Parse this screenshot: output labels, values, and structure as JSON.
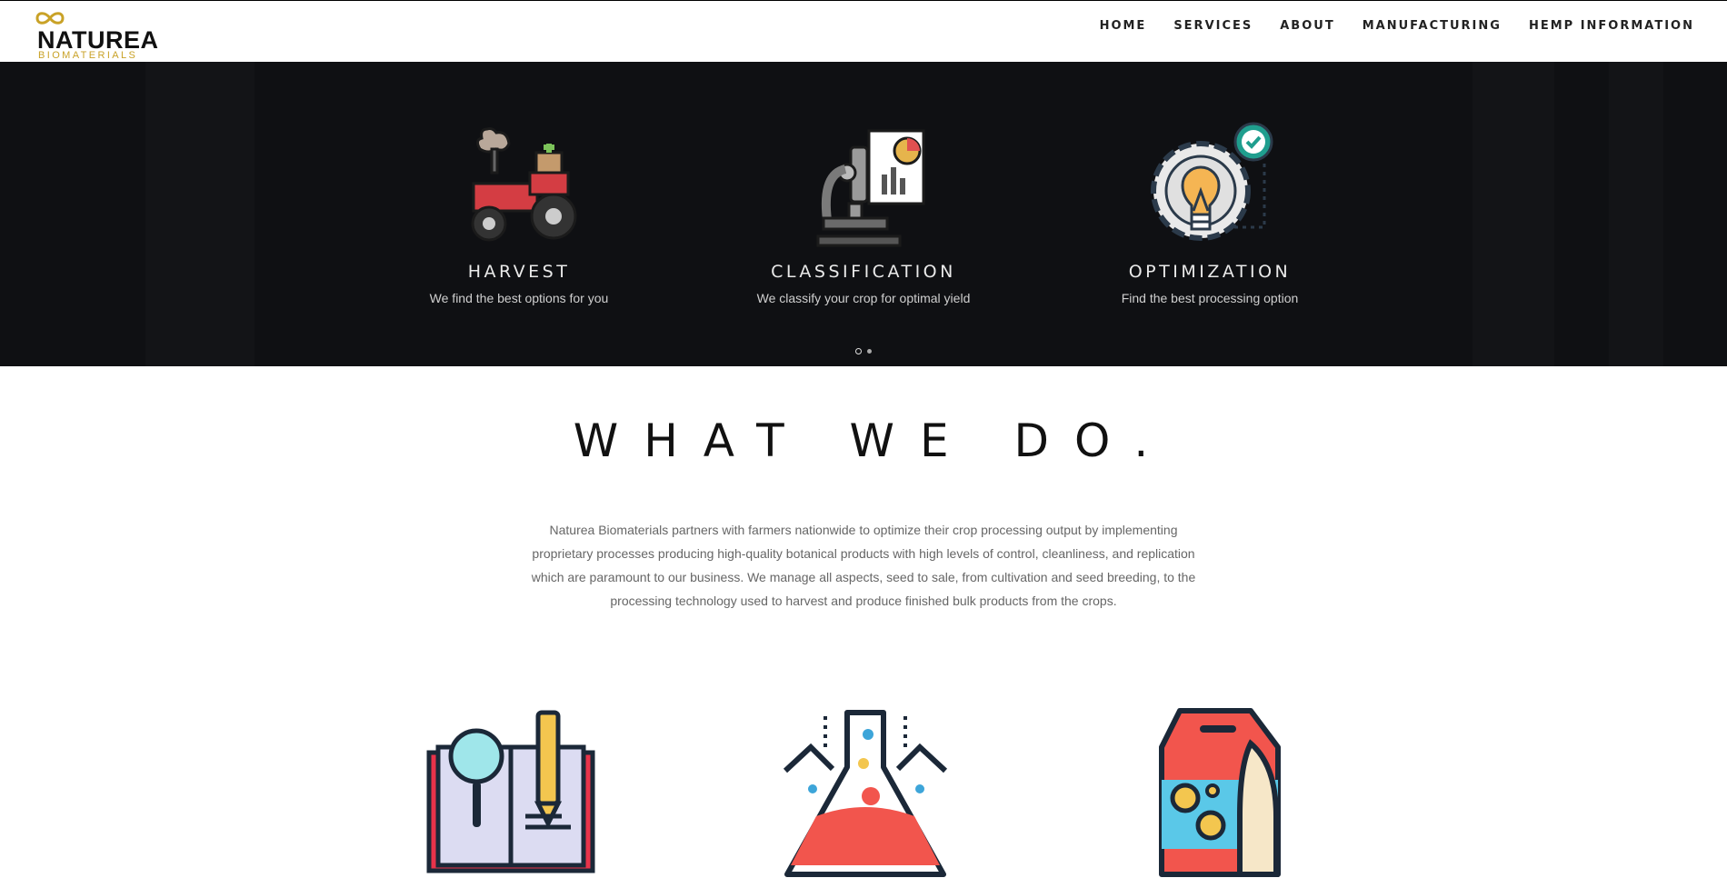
{
  "header": {
    "logo": {
      "brand": "NATUREA",
      "sub": "BIOMATERIALS"
    },
    "nav": [
      {
        "label": "HOME"
      },
      {
        "label": "SERVICES"
      },
      {
        "label": "ABOUT"
      },
      {
        "label": "MANUFACTURING"
      },
      {
        "label": "HEMP INFORMATION"
      }
    ]
  },
  "hero": {
    "features": [
      {
        "title": "HARVEST",
        "desc": "We find the best options for you",
        "icon": "tractor-icon"
      },
      {
        "title": "CLASSIFICATION",
        "desc": "We classify your crop for optimal yield",
        "icon": "microscope-icon"
      },
      {
        "title": "OPTIMIZATION",
        "desc": "Find the best processing option",
        "icon": "lightbulb-gear-icon"
      }
    ],
    "slider": {
      "count": 2,
      "active": 1
    }
  },
  "about": {
    "title": "WHAT WE DO.",
    "body": "Naturea Biomaterials partners with farmers nationwide to optimize their crop processing output by implementing proprietary processes producing high-quality botanical products with high levels of control, cleanliness, and replication which are paramount to our business. We manage all aspects, seed to sale, from cultivation and seed breeding, to the processing technology used to harvest and produce finished bulk products from the crops."
  },
  "icons": [
    "research-book-icon",
    "flask-icon",
    "seed-bag-icon"
  ],
  "colors": {
    "accent": "#c9a227",
    "hero_bg": "#0f1013"
  }
}
